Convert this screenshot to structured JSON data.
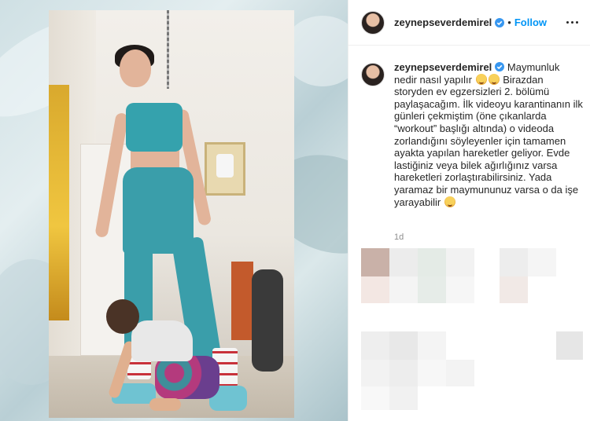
{
  "post": {
    "username": "zeynepseverdemirel",
    "follow_label": "Follow",
    "separator": "•",
    "caption_text": "Maymunluk nedir nasıl yapılır",
    "caption_text_2": " Birazdan storyden ev egzersizleri 2. bölümü paylaşacağım. İlk videoyu karantinanın ilk günleri çekmiştim (öne çıkanlarda “workout” başlığı altında) o videoda zorlandığını söyleyenler için tamamen ayakta yapılan hareketler geliyor. Evde lastiğiniz veya bilek ağırlığınız varsa hareketleri zorlaştırabilirsiniz. Yada yaramaz bir maymununuz varsa o da işe yarayabilir",
    "timestamp": "1d"
  },
  "icons": {
    "verified": "verified-badge-icon",
    "more": "more-options-icon",
    "emoji": "grinning-face-emoji"
  },
  "colors": {
    "link_blue": "#0095f6",
    "verified_blue": "#3897f0",
    "text": "#262626",
    "muted": "#8e8e8e"
  }
}
